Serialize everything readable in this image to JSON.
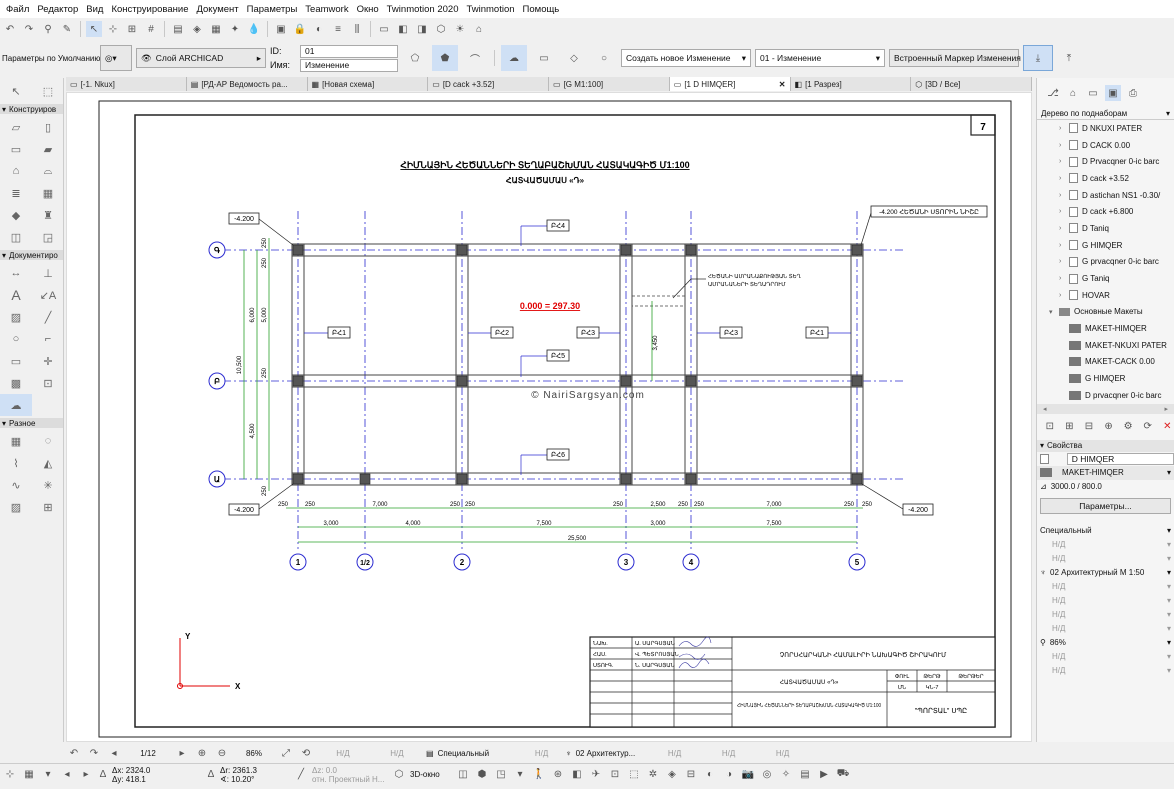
{
  "menu": [
    "Файл",
    "Редактор",
    "Вид",
    "Конструирование",
    "Документ",
    "Параметры",
    "Teamwork",
    "Окно",
    "Twinmotion 2020",
    "Twinmotion",
    "Помощь"
  ],
  "infobox": {
    "defaults_label": "Параметры по Умолчанию",
    "layer": "Слой ARCHICAD",
    "id_label": "ID:",
    "id_value": "01",
    "name_label": "Имя:",
    "name_value": "Изменение",
    "change_select": "Создать новое Изменение",
    "change_value": "01 - Изменение",
    "marker": "Встроенный Маркер Изменения"
  },
  "tabs": [
    "[-1. Nkux]",
    "[РД-АР Ведомость ра...",
    "[Новая схема]",
    "[D cack +3.52]",
    "[G M1:100]",
    "[1 D HIMQER]",
    "[1 Разрез]",
    "[3D / Все]"
  ],
  "toolbox": {
    "section_construct": "Конструиров",
    "section_document": "Документиро",
    "section_misc": "Разное"
  },
  "navigator": {
    "title": "Дерево по поднаборам",
    "items": [
      "D NKUXI PATER",
      "D CACK 0.00",
      "D Prvacqner 0-ic barc",
      "D cack +3.52",
      "D astichan NS1 -0.30/",
      "D cack +6.800",
      "D Taniq",
      "G HIMQER",
      "G prvacqner 0-ic barc",
      "G Taniq",
      "HOVAR",
      "Основные Макеты",
      "MAKET-HIMQER",
      "MAKET-NKUXI PATER",
      "MAKET-CACK 0.00",
      "G HIMQER",
      "D prvacqner 0-ic barc"
    ]
  },
  "properties": {
    "title": "Свойства",
    "name": "D HIMQER",
    "layout": "MAKET-HIMQER",
    "size": "3000.0 / 800.0",
    "params_button": "Параметры...",
    "rows": [
      "Специальный",
      "Н/Д",
      "Н/Д",
      "02 Архитектурный М 1:50",
      "Н/Д",
      "Н/Д",
      "Н/Д",
      "Н/Д",
      "86%",
      "Н/Д",
      "Н/Д"
    ]
  },
  "status": {
    "page": "1/12",
    "zoom": "86%",
    "nd1": "Н/Д",
    "nd2": "Н/Д",
    "pen": "Специальный",
    "nd3": "Н/Д",
    "scale": "02 Архитектур...",
    "nd4": "Н/Д",
    "nd5": "Н/Д",
    "nd6": "Н/Д"
  },
  "coords": {
    "dx": "2324.0",
    "dy": "418.1",
    "dr": "2361.3",
    "da": "10.20°",
    "dz": "0.0",
    "ref": "отн. Проектный Н...",
    "view3d": "3D-окно"
  },
  "drawing": {
    "sheet_no": "7",
    "title_line1": "ՀԻՄՆԱՅԻՆ ՀԵԾԱՆՆԵՐԻ ՏԵՂԱԲԱՇԽՄԱՆ ՀԱՏԱԿԱԳԻԾ Մ1:100",
    "title_line2": "ՀԱՏՎԱԾԱՄԱՍ «Դ»",
    "level": "0.000 = 297.30",
    "watermark": "© NairiSargsyan.com",
    "beam_labels": [
      "ԲՀ4",
      "ԲՀ5",
      "ԲՀ6",
      "ԲՀ1",
      "ԲՀ2",
      "ԲՀ3",
      "ԲՀ3",
      "ԲՀ1"
    ],
    "elev_left_top": "-4.200",
    "elev_right_top": "-4.200 ՀԵԾԱՆԻ ՍՏՈՐԻՆ ՆԻՇԸ",
    "elev_left_bottom": "-4.200",
    "elev_right_bottom": "-4.200",
    "callout": [
      "ՀԵԾԱՆԻ ԱՄՐԱՆԱՔՈՒԹՅԱՆ ՏԵՂ",
      "ԱՄՐԱՆԱՆԵՐԻ ՏԵՂԱԴՐՈՒՄ"
    ],
    "axes_v": [
      "1",
      "1/2",
      "2",
      "3",
      "4",
      "5"
    ],
    "axes_h": [
      "Գ",
      "Բ",
      "Ա"
    ],
    "dims_row1": [
      "250",
      "250",
      "7,000",
      "250",
      "250",
      "250",
      "2,500",
      "250",
      "250",
      "7,000",
      "250",
      "250"
    ],
    "dims_row2": [
      "3,000",
      "4,000",
      "7,500",
      "3,000",
      "7,500"
    ],
    "dims_total": "25,500",
    "dims_left": [
      "10,500",
      "6,000",
      "4,500",
      "5,000",
      "250",
      "250",
      "250",
      "250"
    ],
    "dim_inner": "3,450",
    "stamp": {
      "roles": [
        "ՆԱԽ.",
        "ՀԱՍ.",
        "ՍՏՈՒԳ."
      ],
      "names": [
        "Ա. ՍԱՐԳՍՅԱՆ",
        "Վ. ՊԵՏՐՈՍՅԱՆ",
        "Ն. ՍԱՐԳՍՅԱՆ"
      ],
      "project": "ՉՈՐՍՀԱՐԿԱՆԻ ՀԱՄԱԼԻՐԻ ՆԱԽԱԳԻԾ ՇԻՐԱԿՈՒՄ",
      "section": "ՀԱՏՎԱԾԱՄԱՍ «Դ»",
      "col_headers": [
        "ՓՈՒԼ",
        "ԹԵՐԹ",
        "ԹԵՐԹԵՐ"
      ],
      "col_values": [
        "ՄՆ",
        "ԿՆ-7",
        ""
      ],
      "sheet_title": "ՀԻՄՆԱՅԻՆ ՀԵԾԱՆՆԵՐԻ ՏԵՂԱԲԱՇԽՄԱՆ ՀԱՏԱԿԱԳԻԾ Մ1:100",
      "company": "\"ՊՈՐՏԱԼ\" ՍՊԸ"
    },
    "ucs_x": "X",
    "ucs_y": "Y"
  },
  "colors": {
    "accent": "#2f7fd8",
    "dim": "#2aa02a",
    "axis": "#2b2bd0",
    "level": "#e00000",
    "column": "#555555"
  }
}
